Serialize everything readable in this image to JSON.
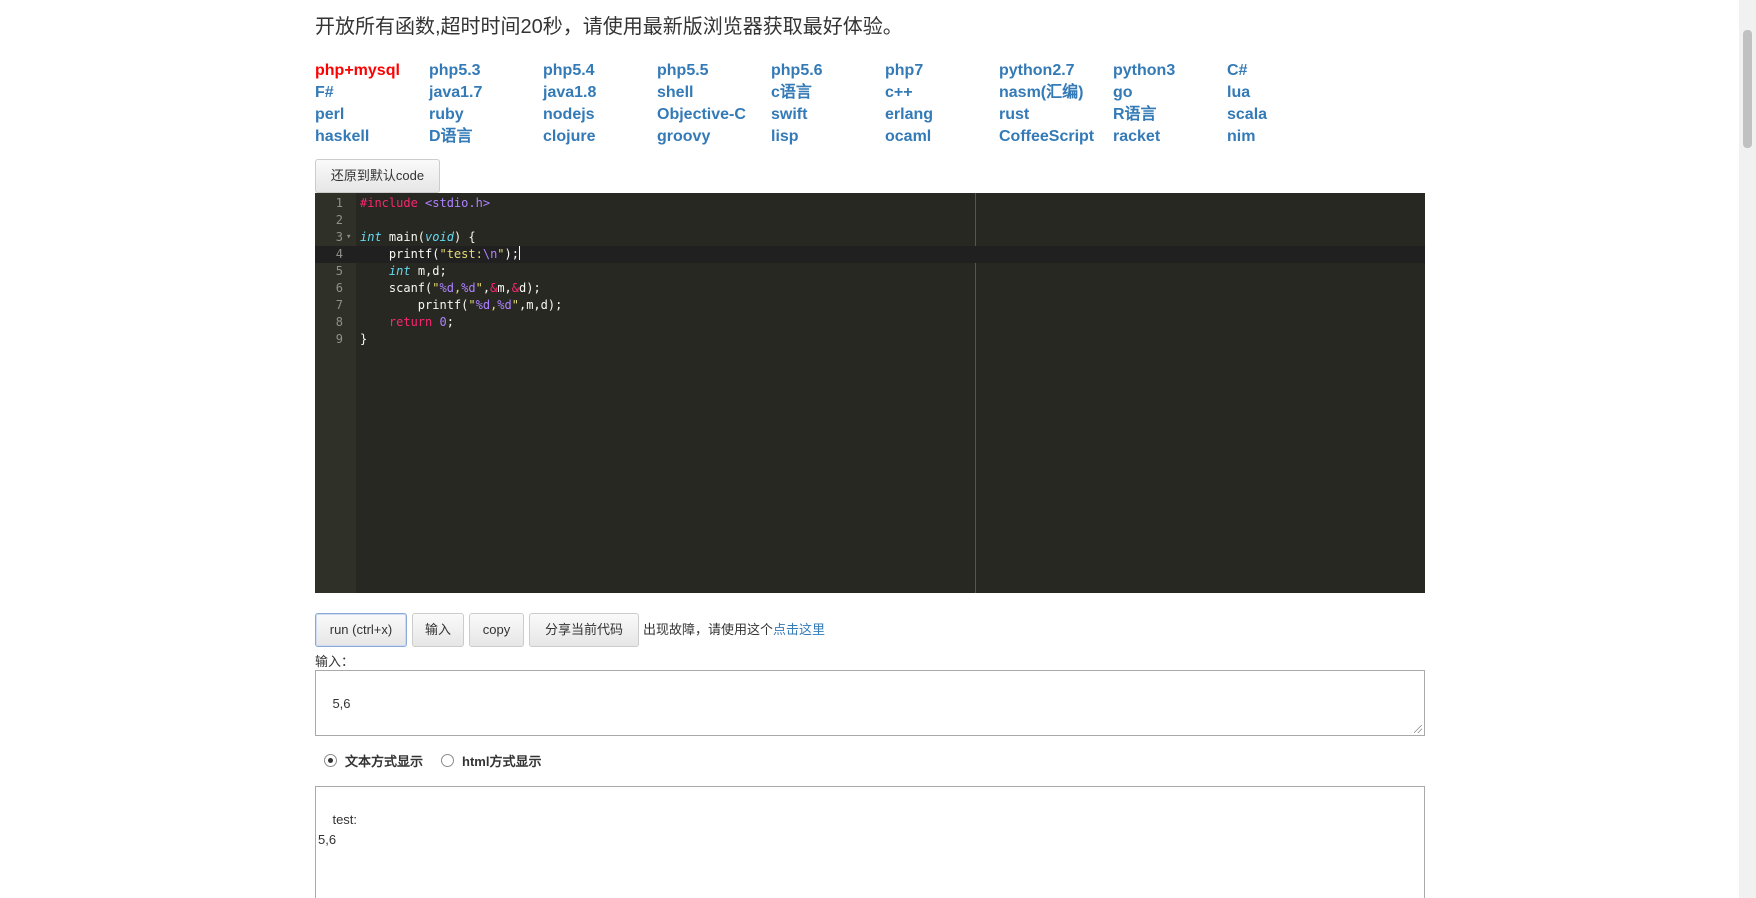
{
  "notice": "开放所有函数,超时时间20秒，请使用最新版浏览器获取最好体验。",
  "languages": [
    [
      "php+mysql",
      "php5.3",
      "php5.4",
      "php5.5",
      "php5.6",
      "php7",
      "python2.7",
      "python3",
      "C#"
    ],
    [
      "F#",
      "java1.7",
      "java1.8",
      "shell",
      "c语言",
      "c++",
      "nasm(汇编)",
      "go",
      "lua"
    ],
    [
      "perl",
      "ruby",
      "nodejs",
      "Objective-C",
      "swift",
      "erlang",
      "rust",
      "R语言",
      "scala"
    ],
    [
      "haskell",
      "D语言",
      "clojure",
      "groovy",
      "lisp",
      "ocaml",
      "CoffeeScript",
      "racket",
      "nim"
    ]
  ],
  "active_language": "php+mysql",
  "accent_color": "#337ab7",
  "active_color": "#ff0000",
  "restore_button": "还原到默认code",
  "editor": {
    "theme_bg": "#272822",
    "line_numbers": [
      "1",
      "2",
      "3",
      "4",
      "5",
      "6",
      "7",
      "8",
      "9"
    ],
    "current_line": 4,
    "lines": [
      "#include <stdio.h>",
      "",
      "int main(void) {",
      "    printf(\"test:\\n\");",
      "    int m,d;",
      "    scanf(\"%d,%d\",&m,&d);",
      "        printf(\"%d,%d\",m,d);",
      "    return 0;",
      "}"
    ]
  },
  "toolbar": {
    "run": "run (ctrl+x)",
    "input": "输入",
    "copy": "copy",
    "share": "分享当前代码",
    "hint_text": "出现故障，请使用这个",
    "hint_link": "点击这里"
  },
  "input_section": {
    "label": "输入：",
    "value": "5,6"
  },
  "display_mode": {
    "text_option": "文本方式显示",
    "html_option": "html方式显示",
    "selected": "text"
  },
  "output": {
    "value": "test:\n5,6"
  }
}
